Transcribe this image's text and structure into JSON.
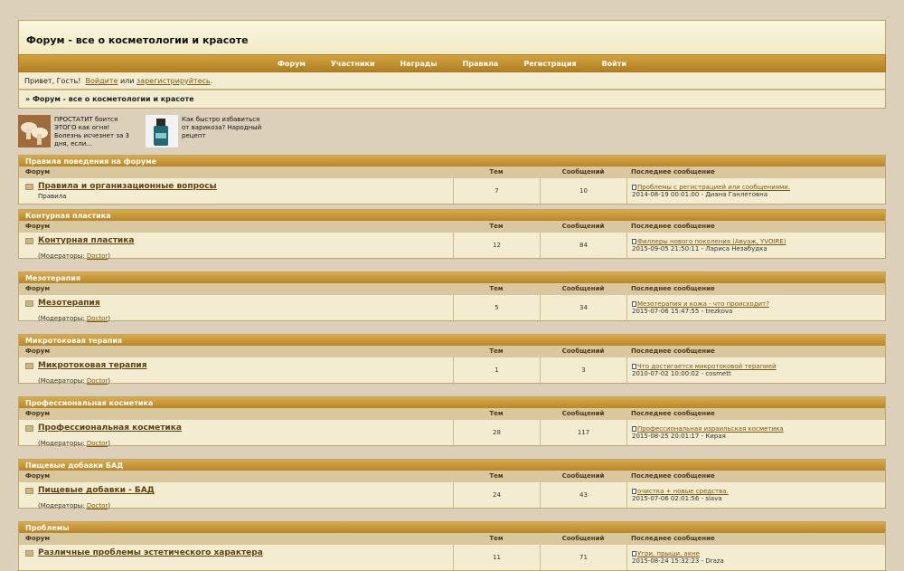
{
  "header": {
    "title": "Форум - все о косметологии и красоте"
  },
  "nav": [
    "Форум",
    "Участники",
    "Награды",
    "Правила",
    "Регистрация",
    "Войти"
  ],
  "info": {
    "greeting": "Привет, Гость!",
    "login": "Войдите",
    "or": "или",
    "register": "зарегистрируйтесь",
    "end": "."
  },
  "breadcrumb": {
    "arrow": "»",
    "text": "Форум - все о косметологии и красоте"
  },
  "ads": [
    {
      "text": "ПРОСТАТИТ боится ЭТОГО как огня! Болезнь исчезнет за 3 дня, если..."
    },
    {
      "text": "Как быстро избавиться от варикоза? Народный рецепт"
    }
  ],
  "table_headers": {
    "forum": "Форум",
    "topics": "Тем",
    "posts": "Сообщений",
    "last": "Последнее сообщение"
  },
  "moderators_label": "(Модераторы:",
  "categories": [
    {
      "title": "Правила поведения на форуме",
      "forum": "Правила и организационные вопросы",
      "sub": "Правила",
      "mod": "",
      "topics": "7",
      "posts": "10",
      "last_title": "Проблемы с регистрацией или сообщениями.",
      "last_meta": "2014-08-19 00:01:00 - Диана Ганлетовна"
    },
    {
      "title": "Контурная пластика",
      "forum": "Контурная пластика",
      "sub": "",
      "mod": "Doctor",
      "topics": "12",
      "posts": "84",
      "last_title": "Филлеры нового поколения (Авуаж, YVOIRE)",
      "last_meta": "2015-09-05 21:50:11 - Лариса Незабудка"
    },
    {
      "title": "Мезотерапия",
      "forum": "Мезотерапия",
      "sub": "",
      "mod": "Doctor",
      "topics": "5",
      "posts": "34",
      "last_title": "Мезотерапия и кожа - что происходит?",
      "last_meta": "2015-07-06 15:47:55 - trezkova"
    },
    {
      "title": "Микротоковая терапия",
      "forum": "Микротоковая терапия",
      "sub": "",
      "mod": "Doctor",
      "topics": "1",
      "posts": "3",
      "last_title": "Что достигается микротоковой терапией",
      "last_meta": "2010-07-02 10:00:02 - cosmett"
    },
    {
      "title": "Профессиональная косметика",
      "forum": "Профессиональная косметика",
      "sub": "",
      "mod": "Doctor",
      "topics": "28",
      "posts": "117",
      "last_title": "Профессиональная израильская косметика",
      "last_meta": "2015-08-25 20:01:17 - Кирая"
    },
    {
      "title": "Пищевые добавки БАД",
      "forum": "Пищевые добавки - БАД",
      "sub": "",
      "mod": "Doctor",
      "topics": "24",
      "posts": "43",
      "last_title": "очистка + новые средства.",
      "last_meta": "2015-07-06 02:01:56 - slava"
    },
    {
      "title": "Проблемы",
      "forum": "Различные проблемы эстетического характера",
      "sub": "",
      "mod": "",
      "topics": "11",
      "posts": "71",
      "last_title": "Угри, прыщи, акне",
      "last_meta": "2015-08-24 15:32:23 - Draza"
    }
  ]
}
